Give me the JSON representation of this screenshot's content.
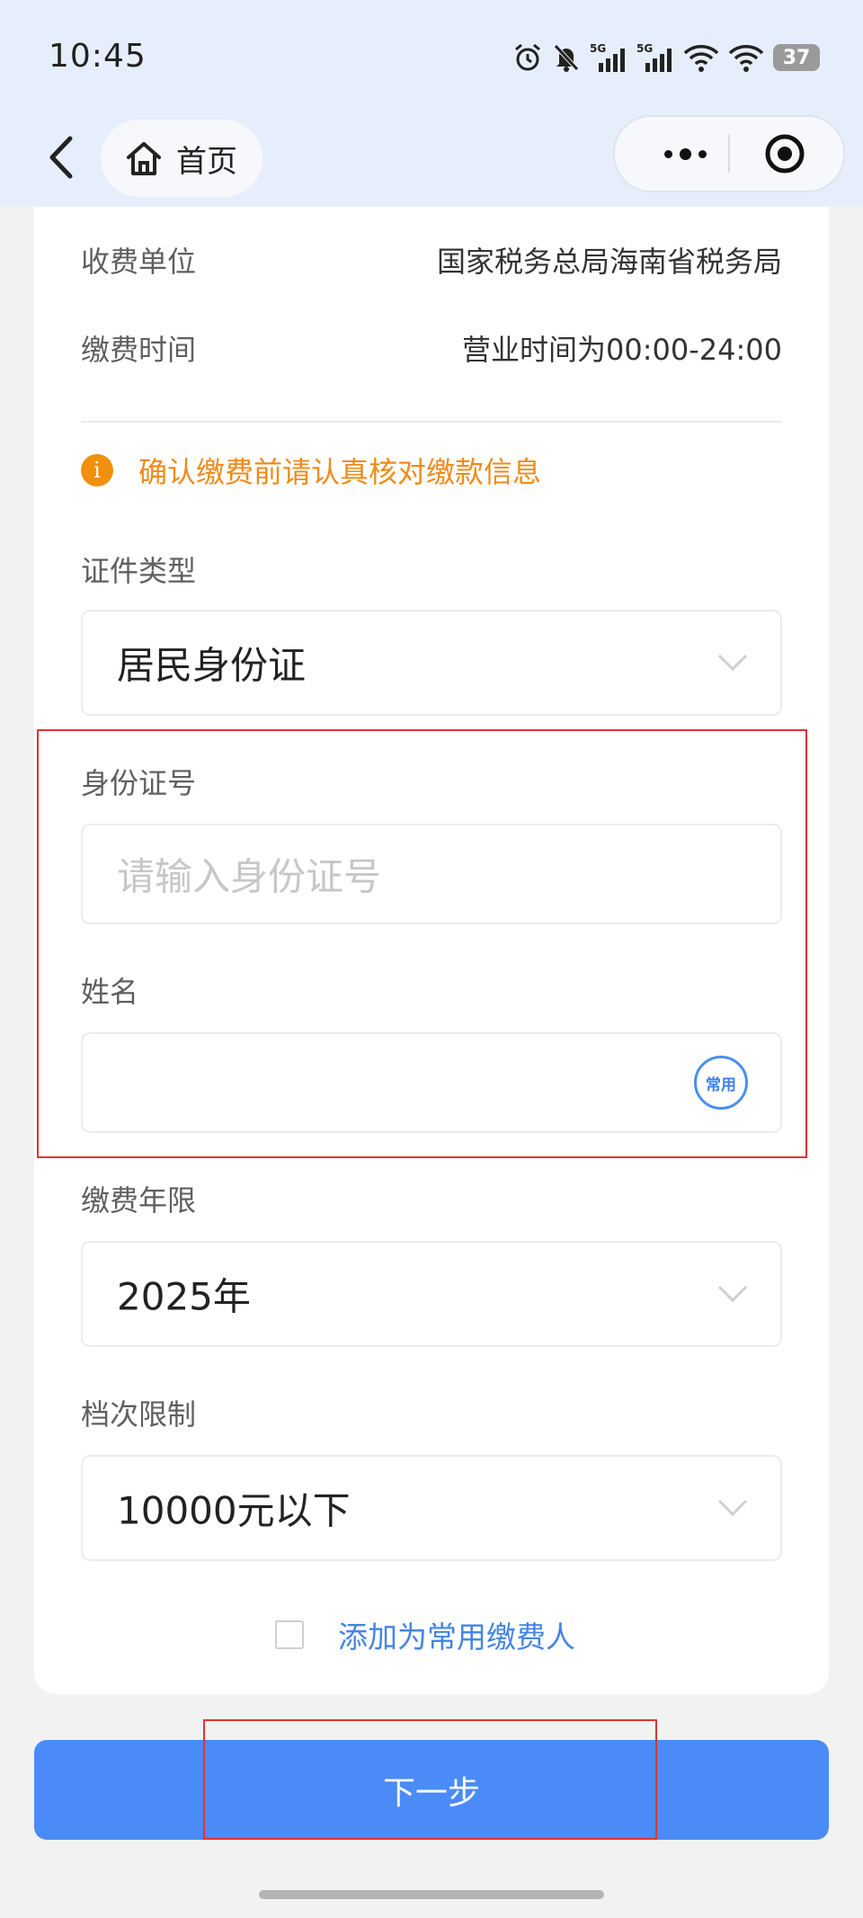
{
  "status_bar": {
    "time": "10:45",
    "battery": "37",
    "signal1": "5G",
    "signal2": "5G"
  },
  "nav": {
    "home_label": "首页"
  },
  "info": {
    "payee_label": "收费单位",
    "payee_value": "国家税务总局海南省税务局",
    "time_label": "缴费时间",
    "time_value": "营业时间为00:00-24:00"
  },
  "notice": {
    "icon_text": "i",
    "text": "确认缴费前请认真核对缴款信息"
  },
  "form": {
    "id_type": {
      "label": "证件类型",
      "value": "居民身份证"
    },
    "id_number": {
      "label": "身份证号",
      "placeholder": "请输入身份证号",
      "value": ""
    },
    "name": {
      "label": "姓名",
      "value": "",
      "badge": "常用"
    },
    "year": {
      "label": "缴费年限",
      "value": "2025年"
    },
    "tier": {
      "label": "档次限制",
      "value": "10000元以下"
    }
  },
  "add_payer": {
    "label": "添加为常用缴费人",
    "checked": false
  },
  "next_button": {
    "label": "下一步"
  },
  "colors": {
    "accent": "#4a8bf7",
    "warning": "#f0900c",
    "highlight": "#e23232"
  }
}
